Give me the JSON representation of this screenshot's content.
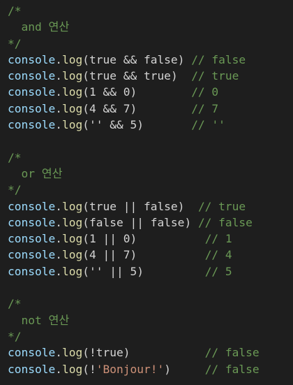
{
  "colors": {
    "background": "#1e1e1e",
    "comment": "#6a9955",
    "identifier": "#9cdcfe",
    "function": "#dcdcaa",
    "punctuation": "#d4d4d4",
    "string": "#ce9178"
  },
  "blocks": [
    {
      "comment_open": "/*",
      "comment_title": "  and 연산",
      "comment_close": "*/",
      "lines": [
        {
          "obj": "console",
          "dot": ".",
          "fn": "log",
          "open": "(",
          "expr": "true && false",
          "close": ")",
          "pad": " ",
          "comment": "// false"
        },
        {
          "obj": "console",
          "dot": ".",
          "fn": "log",
          "open": "(",
          "expr": "true && true",
          "close": ")",
          "pad": "  ",
          "comment": "// true"
        },
        {
          "obj": "console",
          "dot": ".",
          "fn": "log",
          "open": "(",
          "expr": "1 && 0",
          "close": ")",
          "pad": "        ",
          "comment": "// 0"
        },
        {
          "obj": "console",
          "dot": ".",
          "fn": "log",
          "open": "(",
          "expr": "4 && 7",
          "close": ")",
          "pad": "        ",
          "comment": "// 7"
        },
        {
          "obj": "console",
          "dot": ".",
          "fn": "log",
          "open": "(",
          "expr": "'' && 5",
          "close": ")",
          "pad": "       ",
          "comment": "// ''"
        }
      ]
    },
    {
      "comment_open": "/*",
      "comment_title": "  or 연산",
      "comment_close": "*/",
      "lines": [
        {
          "obj": "console",
          "dot": ".",
          "fn": "log",
          "open": "(",
          "expr": "true || false",
          "close": ")",
          "pad": "  ",
          "comment": "// true"
        },
        {
          "obj": "console",
          "dot": ".",
          "fn": "log",
          "open": "(",
          "expr": "false || false",
          "close": ")",
          "pad": " ",
          "comment": "// false"
        },
        {
          "obj": "console",
          "dot": ".",
          "fn": "log",
          "open": "(",
          "expr": "1 || 0",
          "close": ")",
          "pad": "          ",
          "comment": "// 1"
        },
        {
          "obj": "console",
          "dot": ".",
          "fn": "log",
          "open": "(",
          "expr": "4 || 7",
          "close": ")",
          "pad": "          ",
          "comment": "// 4"
        },
        {
          "obj": "console",
          "dot": ".",
          "fn": "log",
          "open": "(",
          "expr": "'' || 5",
          "close": ")",
          "pad": "         ",
          "comment": "// 5"
        }
      ]
    },
    {
      "comment_open": "/*",
      "comment_title": "  not 연산",
      "comment_close": "*/",
      "lines": [
        {
          "obj": "console",
          "dot": ".",
          "fn": "log",
          "open": "(",
          "expr": "!true",
          "close": ")",
          "pad": "           ",
          "comment": "// false"
        },
        {
          "obj": "console",
          "dot": ".",
          "fn": "log",
          "open": "(",
          "expr_prefix": "!",
          "expr_string": "'Bonjour!'",
          "close": ")",
          "pad": "     ",
          "comment": "// false"
        }
      ]
    }
  ]
}
